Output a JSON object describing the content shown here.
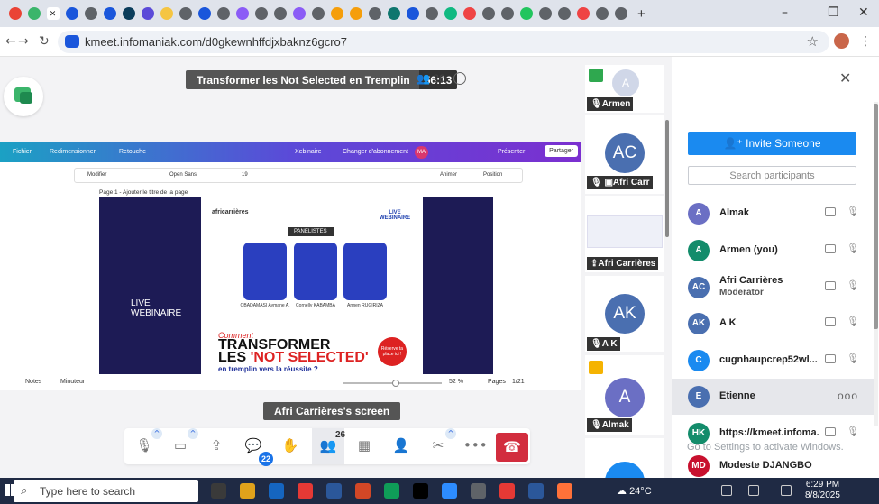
{
  "browser": {
    "url": "kmeet.infomaniak.com/d0gkewnhffdjxbaknz6gcro7",
    "tab_colors": [
      "#ea4335",
      "#3bb56b",
      "#ffffff",
      "#1a56db",
      "#5f6368",
      "#1a56db",
      "#0b3d5b",
      "#5b4ad8",
      "#f5c542",
      "#5f6368",
      "#1a56db",
      "#5f6368",
      "#8b5cf6",
      "#5f6368",
      "#5f6368",
      "#8b5cf6",
      "#5f6368",
      "#f59e0b",
      "#f59e0b",
      "#5f6368",
      "#0f766e",
      "#1a56db",
      "#5f6368",
      "#10b981",
      "#ef4444",
      "#5f6368",
      "#5f6368",
      "#22c55e",
      "#5f6368",
      "#5f6368",
      "#ef4444",
      "#5f6368",
      "#5f6368"
    ],
    "new_tab": "+",
    "minimize": "–",
    "maximize": "❐",
    "close": "✕"
  },
  "meeting": {
    "title": "Transformer les Not Selected en Tremplin",
    "timer": "56:13",
    "participant_count": "26"
  },
  "canva": {
    "menu": [
      "Fichier",
      "Redimensionner",
      "Retouche",
      "Xebinaire",
      "Changer d'abonnement",
      "Présenter",
      "Partager"
    ],
    "avatar": "MA",
    "toolbar": [
      "Modifier",
      "Open Sans",
      "19",
      "Animer",
      "Position"
    ],
    "page_label": "Page 1 - Ajouter le titre de la page",
    "slide": {
      "live_webinaire": "LIVE WEBINAIRE",
      "brand": "africarrières",
      "live_tag": "LIVE WEBINAIRE",
      "panelistes": "PANELISTES",
      "panelist1": "OBADAMASI Aymane A.",
      "panelist2": "Cornelly KABAMBA",
      "panelist3": "Armen RUGIRIZA",
      "comment": "Comment",
      "headline1": "TRANSFORMER",
      "headline2a": "LES ",
      "headline2b": "'NOT SELECTED'",
      "sub": "en tremplin vers la réussite ?",
      "badge": "Réserve ta place ici !"
    },
    "bottom": {
      "notes": "Notes",
      "timer": "Minuteur",
      "zoom": "52 %",
      "pages": "Pages",
      "page_count": "1/21"
    }
  },
  "screen_caption": "Afri Carrières's screen",
  "controls": {
    "chat_badge": "22",
    "participants_count": "26",
    "hangup_icon": "phone-hangup-icon"
  },
  "tiles": [
    {
      "name": "Armen",
      "initials": "A",
      "color": "#d0d7e8"
    },
    {
      "name": "Afri Carr",
      "initials": "AC",
      "color": "#4a6fb0"
    },
    {
      "name": "Afri Carrières",
      "initials": "",
      "color": "#ffffff"
    },
    {
      "name": "A K",
      "initials": "AK",
      "color": "#4a6fb0"
    },
    {
      "name": "Almak",
      "initials": "A",
      "color": "#6b6fc4"
    }
  ],
  "panel": {
    "invite_label": "Invite Someone",
    "search_placeholder": "Search participants",
    "participants": [
      {
        "initials": "A",
        "name": "Almak",
        "role": "",
        "color": "#6b6fc4"
      },
      {
        "initials": "A",
        "name": "Armen (you)",
        "role": "",
        "color": "#138c6b"
      },
      {
        "initials": "AC",
        "name": "Afri Carrières",
        "role": "Moderator",
        "color": "#4a6fb0"
      },
      {
        "initials": "AK",
        "name": "A K",
        "role": "",
        "color": "#4a6fb0"
      },
      {
        "initials": "C",
        "name": "cugnhaupcrep52wl...",
        "role": "",
        "color": "#1a8af0"
      },
      {
        "initials": "E",
        "name": "Etienne",
        "role": "",
        "color": "#4a6fb0"
      },
      {
        "initials": "HK",
        "name": "https://kmeet.infoma...",
        "role": "",
        "color": "#138c6b"
      },
      {
        "initials": "MD",
        "name": "Modeste DJANGBO",
        "role": "",
        "color": "#c8102e"
      }
    ],
    "activate_windows": "Go to Settings to activate Windows."
  },
  "taskbar": {
    "search_placeholder": "Type here to search",
    "weather": "24°C",
    "time": "6:29 PM",
    "date": "8/8/2025",
    "app_colors": [
      "#3a3a3a",
      "#e0a21b",
      "#1565c0",
      "#e53935",
      "#2b579a",
      "#d24726",
      "#0f9d58",
      "#000000",
      "#2d8cff",
      "#5f6368",
      "#e53935",
      "#2b579a",
      "#ff7139"
    ]
  }
}
